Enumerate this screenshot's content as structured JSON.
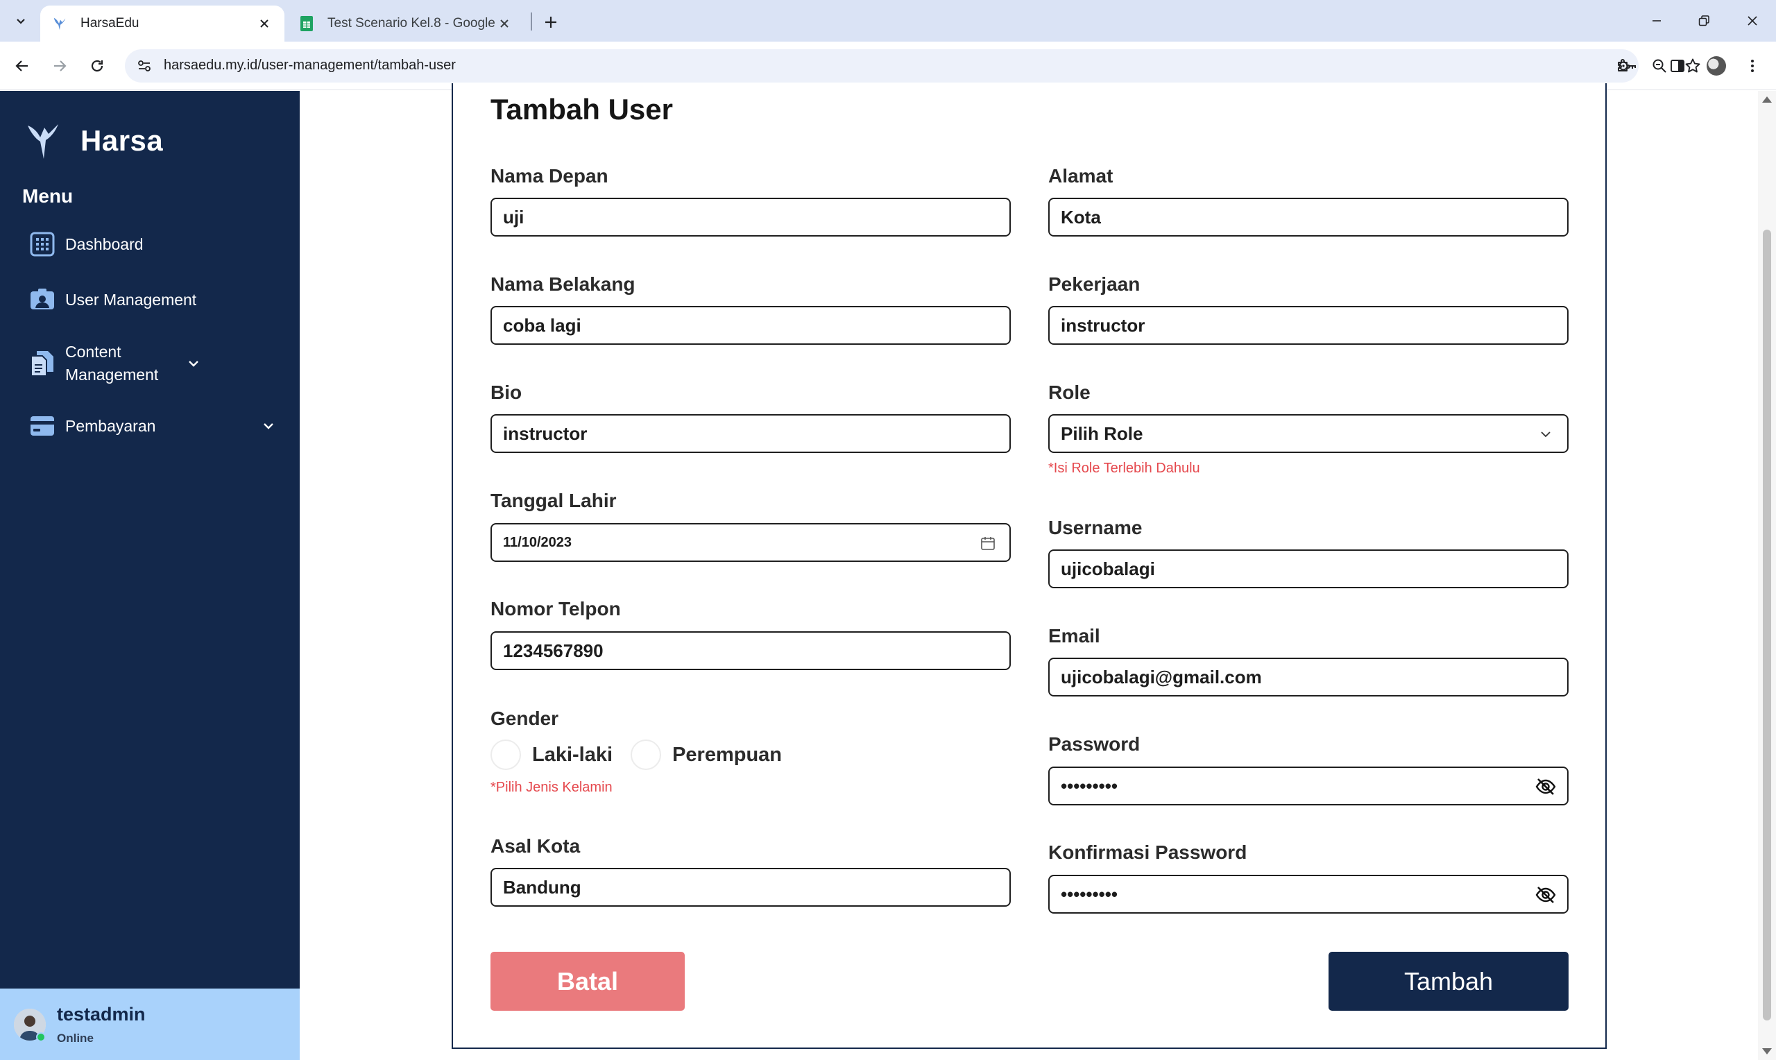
{
  "browser": {
    "tabs": [
      {
        "title": "HarsaEdu",
        "active": true
      },
      {
        "title": "Test Scenario Kel.8 - Google Sp",
        "active": false
      }
    ],
    "url": "harsaedu.my.id/user-management/tambah-user"
  },
  "sidebar": {
    "brand": "Harsa",
    "menu_title": "Menu",
    "items": [
      {
        "label": "Dashboard",
        "icon": "grid-icon",
        "has_chevron": false
      },
      {
        "label": "User Management",
        "icon": "user-card-icon",
        "has_chevron": false
      },
      {
        "label": "Content Management",
        "icon": "documents-icon",
        "has_chevron": true
      },
      {
        "label": "Pembayaran",
        "icon": "credit-card-icon",
        "has_chevron": true
      }
    ],
    "user": {
      "name": "testadmin",
      "status": "Online"
    }
  },
  "form": {
    "title": "Tambah User",
    "nama_depan": {
      "label": "Nama Depan",
      "value": "uji"
    },
    "nama_belakang": {
      "label": "Nama Belakang",
      "value": "coba lagi"
    },
    "bio": {
      "label": "Bio",
      "value": "instructor"
    },
    "tanggal_lahir": {
      "label": "Tanggal Lahir",
      "value": "11/10/2023"
    },
    "nomor_telpon": {
      "label": "Nomor Telpon",
      "value": "1234567890"
    },
    "gender": {
      "label": "Gender",
      "options": [
        "Laki-laki",
        "Perempuan"
      ],
      "error": "*Pilih Jenis Kelamin"
    },
    "asal_kota": {
      "label": "Asal Kota",
      "value": "Bandung"
    },
    "alamat": {
      "label": "Alamat",
      "value": "Kota"
    },
    "pekerjaan": {
      "label": "Pekerjaan",
      "value": "instructor"
    },
    "role": {
      "label": "Role",
      "value": "Pilih Role",
      "error": "*Isi Role Terlebih Dahulu"
    },
    "username": {
      "label": "Username",
      "value": "ujicobalagi"
    },
    "email": {
      "label": "Email",
      "value": "ujicobalagi@gmail.com"
    },
    "password": {
      "label": "Password",
      "value": "•••••••••"
    },
    "konfirmasi_password": {
      "label": "Konfirmasi Password",
      "value": "•••••••••"
    },
    "buttons": {
      "cancel": "Batal",
      "submit": "Tambah"
    }
  },
  "colors": {
    "sidebar": "#13284b",
    "user_bar": "#a9d2fb",
    "cancel_button": "#ea7a7d",
    "submit_button": "#13284b",
    "error_text": "#e5484d"
  }
}
